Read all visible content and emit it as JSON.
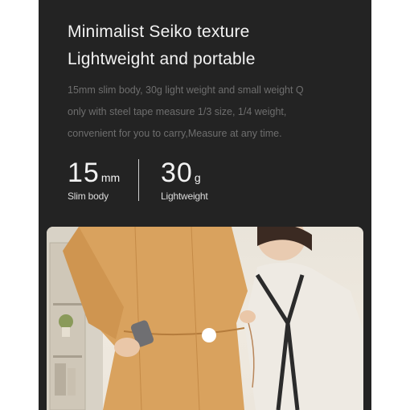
{
  "heading": {
    "line1": "Minimalist Seiko texture",
    "line2": "Lightweight and portable"
  },
  "description": [
    "15mm slim body, 30g light weight and small weight Q",
    "only with steel tape measure 1/3 size, 1/4 weight,",
    "convenient for you to carry,Measure at any time."
  ],
  "stats": [
    {
      "value": "15",
      "unit": "mm",
      "caption": "Slim body"
    },
    {
      "value": "30",
      "unit": "g",
      "caption": "Lightweight"
    }
  ],
  "colors": {
    "background": "#232323",
    "text": "#f2f2f2",
    "muted_text": "#6e6e6e",
    "dress": "#d9a25e"
  }
}
